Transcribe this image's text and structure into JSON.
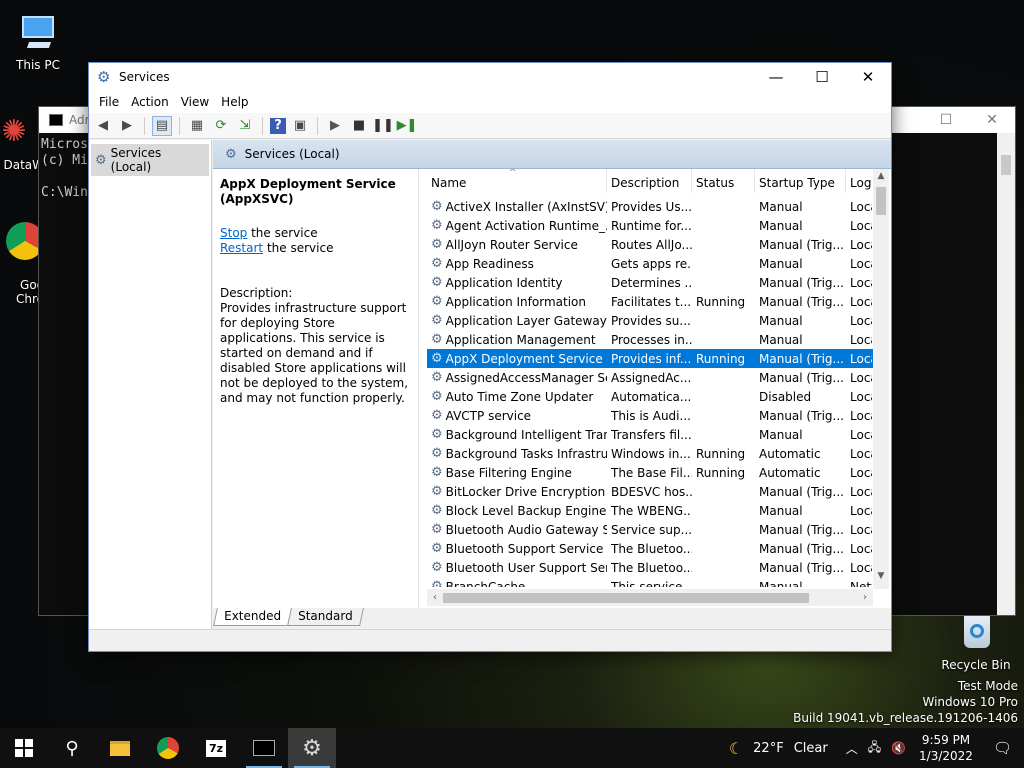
{
  "desktop": {
    "icons": [
      {
        "label": "This PC"
      },
      {
        "label": "DataW"
      },
      {
        "label": "Goo\nChro"
      },
      {
        "label": "Recycle Bin"
      }
    ],
    "watermark": {
      "line1": "Test Mode",
      "line2": "Windows 10 Pro",
      "line3": "Build 19041.vb_release.191206-1406"
    }
  },
  "cmd_window": {
    "title": "Adr",
    "lines": [
      "Micros",
      "(c) Mi",
      "",
      "C:\\Win"
    ]
  },
  "services_window": {
    "title": "Services",
    "menu": [
      "File",
      "Action",
      "View",
      "Help"
    ],
    "tree_item": "Services (Local)",
    "header_title": "Services (Local)",
    "selected_service": {
      "title": "AppX Deployment Service (AppXSVC)",
      "stop_link": "Stop",
      "stop_suffix": " the service",
      "restart_link": "Restart",
      "restart_suffix": " the service",
      "description_label": "Description:",
      "description": "Provides infrastructure support for deploying Store applications. This service is started on demand and if disabled Store applications will not be deployed to the system, and may not function properly."
    },
    "columns": [
      "Name",
      "Description",
      "Status",
      "Startup Type",
      "Log"
    ],
    "rows": [
      {
        "name": "ActiveX Installer (AxInstSV)",
        "desc": "Provides Us...",
        "status": "",
        "startup": "Manual",
        "log": "Loca"
      },
      {
        "name": "Agent Activation Runtime_...",
        "desc": "Runtime for...",
        "status": "",
        "startup": "Manual",
        "log": "Loca"
      },
      {
        "name": "AllJoyn Router Service",
        "desc": "Routes AllJo...",
        "status": "",
        "startup": "Manual (Trig...",
        "log": "Loca"
      },
      {
        "name": "App Readiness",
        "desc": "Gets apps re...",
        "status": "",
        "startup": "Manual",
        "log": "Loca"
      },
      {
        "name": "Application Identity",
        "desc": "Determines ...",
        "status": "",
        "startup": "Manual (Trig...",
        "log": "Loca"
      },
      {
        "name": "Application Information",
        "desc": "Facilitates t...",
        "status": "Running",
        "startup": "Manual (Trig...",
        "log": "Loca"
      },
      {
        "name": "Application Layer Gateway ...",
        "desc": "Provides su...",
        "status": "",
        "startup": "Manual",
        "log": "Loca"
      },
      {
        "name": "Application Management",
        "desc": "Processes in...",
        "status": "",
        "startup": "Manual",
        "log": "Loca"
      },
      {
        "name": "AppX Deployment Service (...",
        "desc": "Provides inf...",
        "status": "Running",
        "startup": "Manual (Trig...",
        "log": "Loca",
        "selected": true
      },
      {
        "name": "AssignedAccessManager Se...",
        "desc": "AssignedAc...",
        "status": "",
        "startup": "Manual (Trig...",
        "log": "Loca"
      },
      {
        "name": "Auto Time Zone Updater",
        "desc": "Automatica...",
        "status": "",
        "startup": "Disabled",
        "log": "Loca"
      },
      {
        "name": "AVCTP service",
        "desc": "This is Audi...",
        "status": "",
        "startup": "Manual (Trig...",
        "log": "Loca"
      },
      {
        "name": "Background Intelligent Tran...",
        "desc": "Transfers fil...",
        "status": "",
        "startup": "Manual",
        "log": "Loca"
      },
      {
        "name": "Background Tasks Infrastruc...",
        "desc": "Windows in...",
        "status": "Running",
        "startup": "Automatic",
        "log": "Loca"
      },
      {
        "name": "Base Filtering Engine",
        "desc": "The Base Fil...",
        "status": "Running",
        "startup": "Automatic",
        "log": "Loca"
      },
      {
        "name": "BitLocker Drive Encryption ...",
        "desc": "BDESVC hos...",
        "status": "",
        "startup": "Manual (Trig...",
        "log": "Loca"
      },
      {
        "name": "Block Level Backup Engine ...",
        "desc": "The WBENG...",
        "status": "",
        "startup": "Manual",
        "log": "Loca"
      },
      {
        "name": "Bluetooth Audio Gateway S...",
        "desc": "Service sup...",
        "status": "",
        "startup": "Manual (Trig...",
        "log": "Loca"
      },
      {
        "name": "Bluetooth Support Service",
        "desc": "The Bluetoo...",
        "status": "",
        "startup": "Manual (Trig...",
        "log": "Loca"
      },
      {
        "name": "Bluetooth User Support Ser...",
        "desc": "The Bluetoo...",
        "status": "",
        "startup": "Manual (Trig...",
        "log": "Loca"
      },
      {
        "name": "BranchCache",
        "desc": "This service ...",
        "status": "",
        "startup": "Manual",
        "log": "Netv"
      }
    ],
    "tabs": [
      "Extended",
      "Standard"
    ]
  },
  "taskbar": {
    "weather": "22°F",
    "weather_text": "Clear",
    "time": "9:59 PM",
    "date": "1/3/2022"
  }
}
